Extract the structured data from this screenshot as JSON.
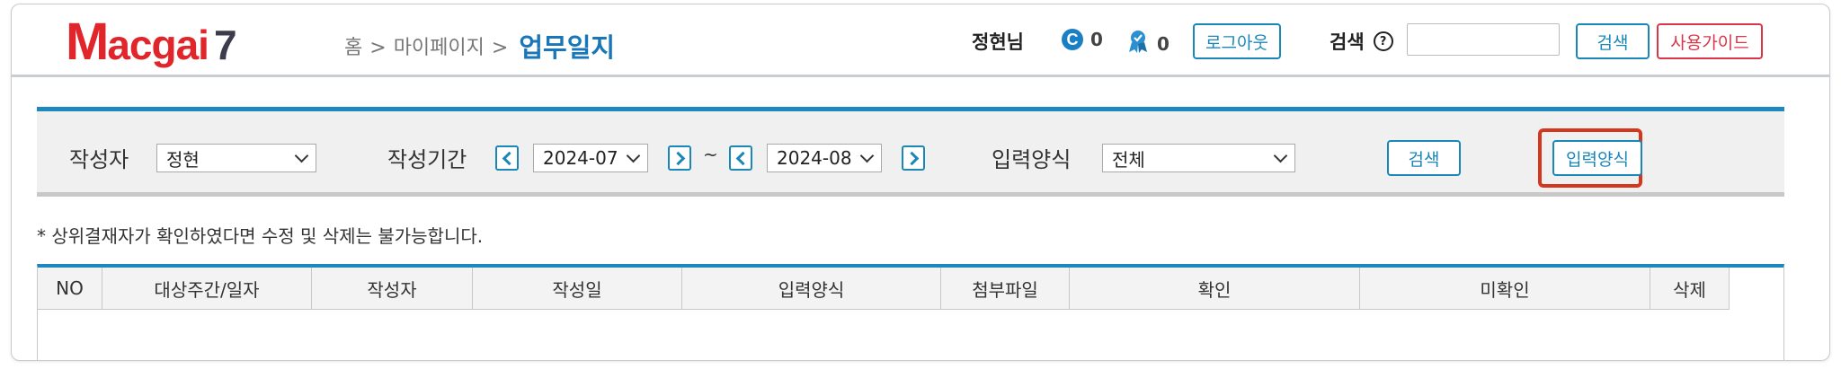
{
  "header": {
    "logo_m": "M",
    "logo_rest": "acgai",
    "logo_num": "7",
    "breadcrumb": {
      "home": "홈",
      "sep1": ">",
      "mypage": "마이페이지",
      "sep2": ">",
      "current": "업무일지"
    },
    "user_name": "정현님",
    "coin_c_icon": "c-coin-icon",
    "coin_c_value": "0",
    "coin_ribbon_icon": "ribbon-icon",
    "coin_ribbon_value": "0",
    "logout_label": "로그아웃",
    "search_label": "검색",
    "search_value": "",
    "search_button": "검색",
    "guide_button": "사용가이드"
  },
  "filter": {
    "author_label": "작성자",
    "author_value": "정현",
    "period_label": "작성기간",
    "period_from": "2024-07",
    "tilde": "~",
    "period_to": "2024-08",
    "format_label": "입력양식",
    "format_value": "전체",
    "search_button": "검색",
    "input_format_button": "입력양식"
  },
  "notice": "* 상위결재자가 확인하였다면 수정 및 삭제는 불가능합니다.",
  "table": {
    "columns": [
      "NO",
      "대상주간/일자",
      "작성자",
      "작성일",
      "입력양식",
      "첨부파일",
      "확인",
      "미확인",
      "삭제"
    ],
    "rows": []
  },
  "colors": {
    "accent": "#1e87c0",
    "brand_red": "#e0262b",
    "highlight": "#d3371e",
    "guide_red": "#d9364a"
  }
}
